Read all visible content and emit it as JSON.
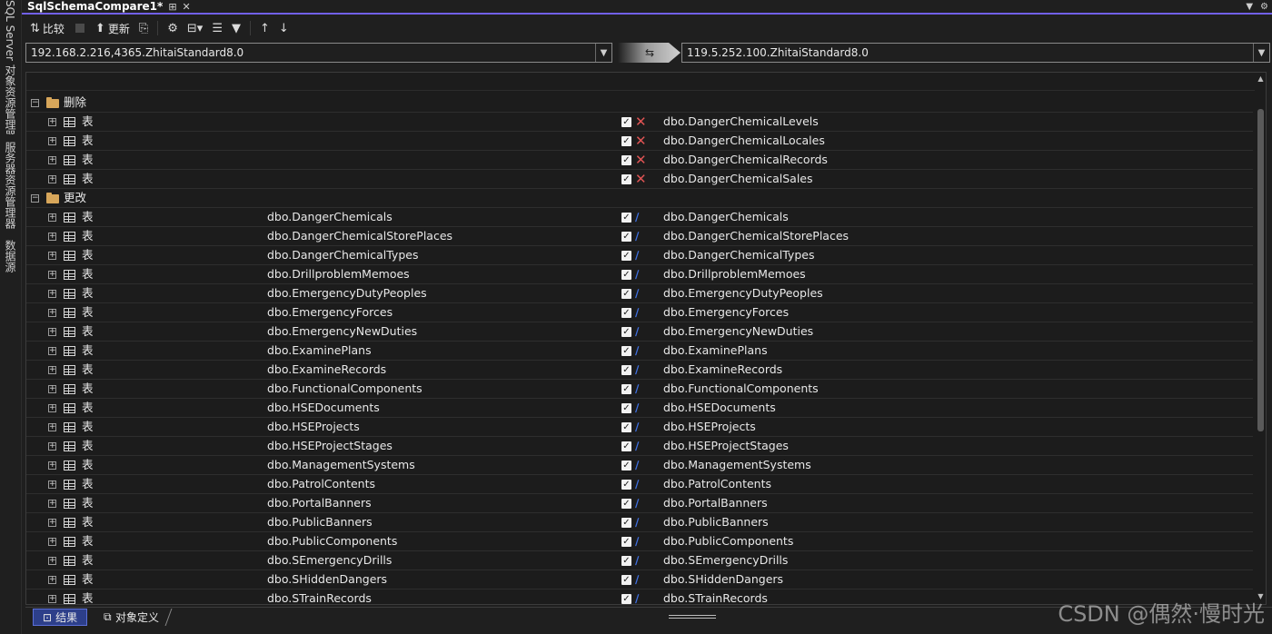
{
  "side_tabs": [
    "SQL Server 对象资源管理器",
    "服务器资源管理器",
    "数据源"
  ],
  "doc_tab": {
    "title": "SqlSchemaCompare1*"
  },
  "toolbar": {
    "compare_label": "比较",
    "update_label": "更新"
  },
  "source": {
    "value": "192.168.2.216,4365.ZhitaiStandard8.0"
  },
  "target": {
    "value": "119.5.252.100.ZhitaiStandard8.0"
  },
  "groups": [
    {
      "label": "删除",
      "rows": [
        {
          "type": "表",
          "source": "",
          "target": "dbo.DangerChemicalLevels",
          "action": "delete"
        },
        {
          "type": "表",
          "source": "",
          "target": "dbo.DangerChemicalLocales",
          "action": "delete"
        },
        {
          "type": "表",
          "source": "",
          "target": "dbo.DangerChemicalRecords",
          "action": "delete"
        },
        {
          "type": "表",
          "source": "",
          "target": "dbo.DangerChemicalSales",
          "action": "delete"
        }
      ]
    },
    {
      "label": "更改",
      "rows": [
        {
          "type": "表",
          "source": "dbo.DangerChemicals",
          "target": "dbo.DangerChemicals",
          "action": "change"
        },
        {
          "type": "表",
          "source": "dbo.DangerChemicalStorePlaces",
          "target": "dbo.DangerChemicalStorePlaces",
          "action": "change"
        },
        {
          "type": "表",
          "source": "dbo.DangerChemicalTypes",
          "target": "dbo.DangerChemicalTypes",
          "action": "change"
        },
        {
          "type": "表",
          "source": "dbo.DrillproblemMemoes",
          "target": "dbo.DrillproblemMemoes",
          "action": "change"
        },
        {
          "type": "表",
          "source": "dbo.EmergencyDutyPeoples",
          "target": "dbo.EmergencyDutyPeoples",
          "action": "change"
        },
        {
          "type": "表",
          "source": "dbo.EmergencyForces",
          "target": "dbo.EmergencyForces",
          "action": "change"
        },
        {
          "type": "表",
          "source": "dbo.EmergencyNewDuties",
          "target": "dbo.EmergencyNewDuties",
          "action": "change"
        },
        {
          "type": "表",
          "source": "dbo.ExaminePlans",
          "target": "dbo.ExaminePlans",
          "action": "change"
        },
        {
          "type": "表",
          "source": "dbo.ExamineRecords",
          "target": "dbo.ExamineRecords",
          "action": "change"
        },
        {
          "type": "表",
          "source": "dbo.FunctionalComponents",
          "target": "dbo.FunctionalComponents",
          "action": "change"
        },
        {
          "type": "表",
          "source": "dbo.HSEDocuments",
          "target": "dbo.HSEDocuments",
          "action": "change"
        },
        {
          "type": "表",
          "source": "dbo.HSEProjects",
          "target": "dbo.HSEProjects",
          "action": "change"
        },
        {
          "type": "表",
          "source": "dbo.HSEProjectStages",
          "target": "dbo.HSEProjectStages",
          "action": "change"
        },
        {
          "type": "表",
          "source": "dbo.ManagementSystems",
          "target": "dbo.ManagementSystems",
          "action": "change"
        },
        {
          "type": "表",
          "source": "dbo.PatrolContents",
          "target": "dbo.PatrolContents",
          "action": "change"
        },
        {
          "type": "表",
          "source": "dbo.PortalBanners",
          "target": "dbo.PortalBanners",
          "action": "change"
        },
        {
          "type": "表",
          "source": "dbo.PublicBanners",
          "target": "dbo.PublicBanners",
          "action": "change"
        },
        {
          "type": "表",
          "source": "dbo.PublicComponents",
          "target": "dbo.PublicComponents",
          "action": "change"
        },
        {
          "type": "表",
          "source": "dbo.SEmergencyDrills",
          "target": "dbo.SEmergencyDrills",
          "action": "change"
        },
        {
          "type": "表",
          "source": "dbo.SHiddenDangers",
          "target": "dbo.SHiddenDangers",
          "action": "change"
        },
        {
          "type": "表",
          "source": "dbo.STrainRecords",
          "target": "dbo.STrainRecords",
          "action": "change"
        }
      ]
    }
  ],
  "bottom_tabs": {
    "results": "结果",
    "object_definitions": "对象定义"
  },
  "watermark": "CSDN @偶然·慢时光",
  "colors": {
    "accent": "#7160e8",
    "delete": "#e05454",
    "change": "#3f6fe0"
  }
}
